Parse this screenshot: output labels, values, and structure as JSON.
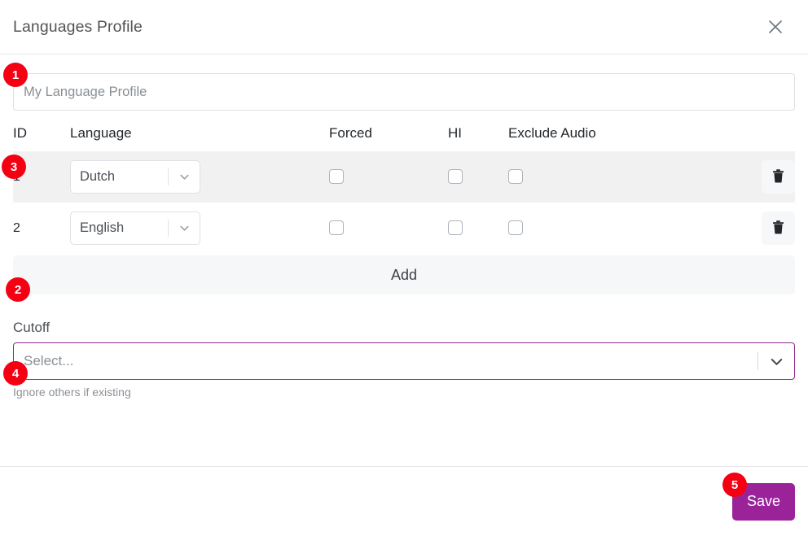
{
  "dialog": {
    "title": "Languages Profile",
    "close_icon": "close-icon"
  },
  "profile_name": {
    "value": "",
    "placeholder": "My Language Profile"
  },
  "table": {
    "headers": {
      "id": "ID",
      "language": "Language",
      "forced": "Forced",
      "hi": "HI",
      "exclude_audio": "Exclude Audio"
    },
    "rows": [
      {
        "id": "1",
        "language": "Dutch",
        "forced": false,
        "hi": false,
        "exclude_audio": false,
        "delete_icon": "trash-icon"
      },
      {
        "id": "2",
        "language": "English",
        "forced": false,
        "hi": false,
        "exclude_audio": false,
        "delete_icon": "trash-icon"
      }
    ]
  },
  "add_row": {
    "label": "Add"
  },
  "cutoff": {
    "label": "Cutoff",
    "placeholder": "Select...",
    "help": "Ignore others if existing"
  },
  "footer": {
    "save_label": "Save"
  },
  "badges": {
    "one": "1",
    "two": "2",
    "three": "3",
    "four": "4",
    "five": "5"
  },
  "colors": {
    "accent_purple": "#9a239a",
    "focus_border": "#8e2a8e",
    "badge_red": "#f50013",
    "row_odd_bg": "#f1f1f2",
    "muted_bg": "#f6f7f9"
  }
}
